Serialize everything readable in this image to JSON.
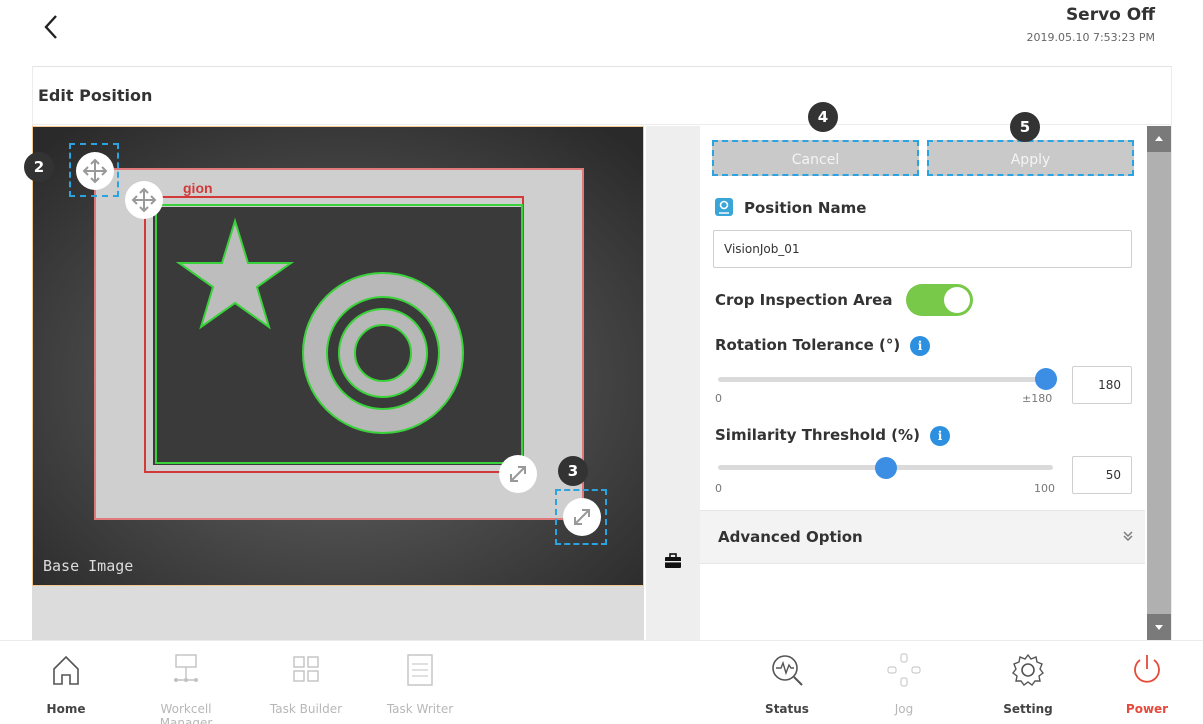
{
  "header": {
    "servo_status": "Servo Off",
    "datetime": "2019.05.10 7:53:23 PM"
  },
  "card": {
    "title": "Edit Position"
  },
  "image_panel": {
    "base_label": "Base Image",
    "region_label": "gion"
  },
  "badges": {
    "b2": "2",
    "b3": "3",
    "b4": "4",
    "b5": "5"
  },
  "buttons": {
    "cancel": "Cancel",
    "apply": "Apply"
  },
  "position_name": {
    "label": "Position Name",
    "value": "VisionJob_01"
  },
  "crop": {
    "label": "Crop Inspection Area",
    "enabled": true
  },
  "rotation": {
    "label": "Rotation Tolerance (°)",
    "min": "0",
    "max": "±180",
    "value": "180",
    "fraction": 1.0
  },
  "similarity": {
    "label": "Similarity Threshold (%)",
    "min": "0",
    "max": "100",
    "value": "50",
    "fraction": 0.5
  },
  "advanced": {
    "label": "Advanced Option"
  },
  "info_glyph": "i",
  "nav": {
    "home": "Home",
    "workcell": "Workcell Manager",
    "task_builder": "Task Builder",
    "task_writer": "Task Writer",
    "status": "Status",
    "jog": "Jog",
    "setting": "Setting",
    "power": "Power"
  },
  "colors": {
    "accent": "#3c8ee4",
    "toggle_on": "#78c84a",
    "power": "#e64a3b",
    "highlight": "#2aa3e0"
  }
}
